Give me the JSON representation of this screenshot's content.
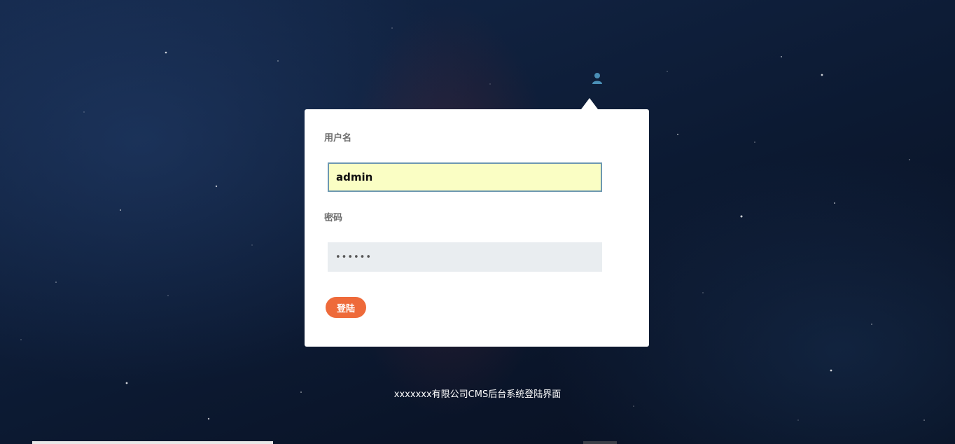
{
  "login": {
    "username_label": "用户名",
    "username_value": "admin",
    "password_label": "密码",
    "password_value": "••••••",
    "submit_label": "登陆"
  },
  "footer": {
    "text": "xxxxxxx有限公司CMS后台系统登陆界面"
  },
  "icons": {
    "user": "user-icon"
  },
  "colors": {
    "accent_button": "#ee6a3a",
    "autofill_bg": "#fafec4",
    "input_border": "#6d98b1",
    "password_bg": "#e9edf0"
  }
}
